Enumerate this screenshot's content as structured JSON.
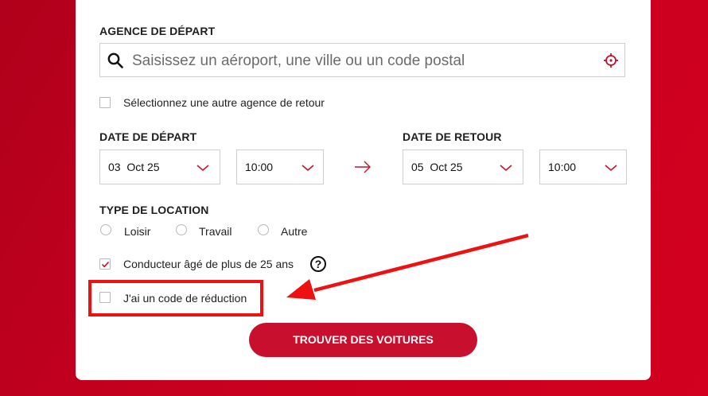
{
  "form": {
    "departure_agency_label": "AGENCE DE DÉPART",
    "search_placeholder": "Saisissez un aéroport, une ville ou un code postal",
    "return_agency_checkbox_label": "Sélectionnez une autre agence de retour",
    "departure_date_label": "DATE DE DÉPART",
    "departure_date_value": "03  Oct 25",
    "departure_time_value": "10:00",
    "return_date_label": "DATE DE RETOUR",
    "return_date_value": "05  Oct 25",
    "return_time_value": "10:00",
    "rental_type_label": "TYPE DE LOCATION",
    "rental_types": [
      "Loisir",
      "Travail",
      "Autre"
    ],
    "driver_age_label": "Conducteur âgé de plus de 25 ans",
    "driver_age_checked": true,
    "help_glyph": "?",
    "discount_code_label": "J'ai un code de réduction",
    "discount_code_checked": false,
    "submit_label": "TROUVER DES VOITURES"
  },
  "icons": {
    "search": "search-icon",
    "locate": "crosshair-icon",
    "chevron": "chevron-down-icon",
    "date_arrow": "arrow-right-icon",
    "check": "checkmark-icon"
  },
  "colors": {
    "brand_red": "#c8102e",
    "annotation_red": "#ee1111",
    "background_red": "#c8001f"
  }
}
